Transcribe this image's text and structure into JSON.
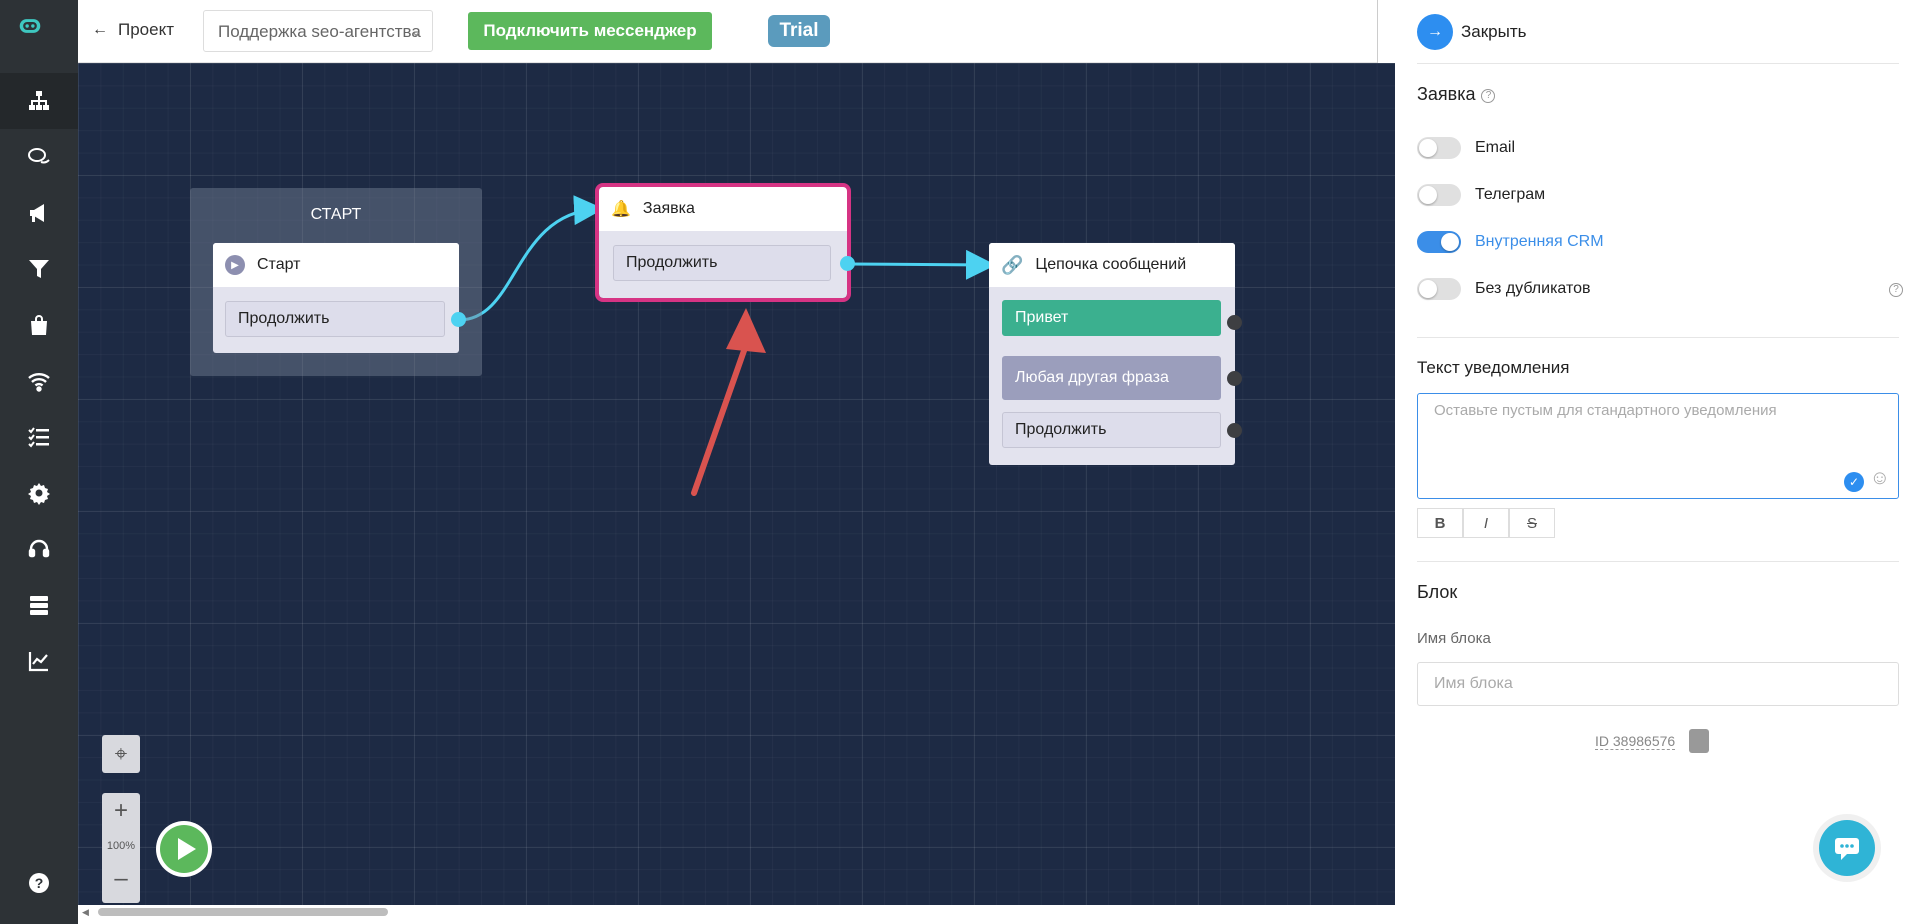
{
  "topbar": {
    "back_label": "Проект",
    "project_name": "Поддержка seo-агентства",
    "connect_label": "Подключить мессенджер",
    "trial_label": "Trial"
  },
  "canvas": {
    "start_group_title": "СТАРТ",
    "start_block": {
      "title": "Старт",
      "button": "Продолжить"
    },
    "request_block": {
      "title": "Заявка",
      "button": "Продолжить"
    },
    "chain_block": {
      "title": "Цепочка сообщений",
      "buttons": [
        "Привет",
        "Любая другая фраза",
        "Продолжить"
      ]
    },
    "zoom_level": "100%"
  },
  "panel": {
    "close_label": "Закрыть",
    "section_title": "Заявка",
    "toggles": [
      {
        "label": "Email",
        "on": false
      },
      {
        "label": "Телеграм",
        "on": false
      },
      {
        "label": "Внутренняя CRM",
        "on": true
      },
      {
        "label": "Без дубликатов",
        "on": false
      }
    ],
    "notify_title": "Текст уведомления",
    "notify_placeholder": "Оставьте пустым для стандартного уведомления",
    "format_buttons": [
      "B",
      "I",
      "S"
    ],
    "block_title": "Блок",
    "block_name_label": "Имя блока",
    "block_name_placeholder": "Имя блока",
    "block_id": "ID 38986576"
  },
  "colors": {
    "sidebar_bg": "#2d3236",
    "canvas_bg": "#1d2a44",
    "link_cyan": "#4dd2f1",
    "selected_border": "#d63484",
    "arrow_red": "#d9534f",
    "accent_blue": "#3b8ee8",
    "green": "#5cb85c"
  }
}
